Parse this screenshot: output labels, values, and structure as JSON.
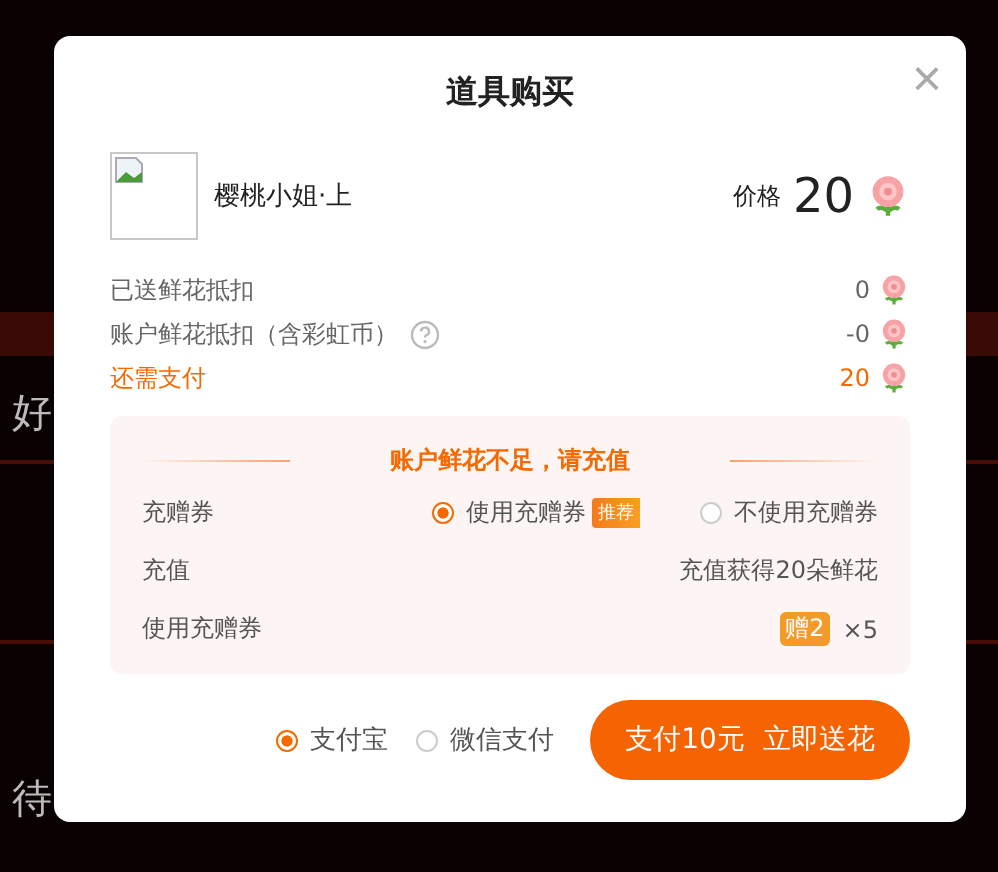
{
  "background": {
    "texts": [
      "好",
      "待"
    ]
  },
  "dialog": {
    "title": "道具购买",
    "close_symbol": "×"
  },
  "item": {
    "name": "樱桃小姐·上",
    "price_label": "价格",
    "price": "20"
  },
  "summary": [
    {
      "label": "已送鲜花抵扣",
      "value": "0",
      "kind": "normal",
      "help": false
    },
    {
      "label": "账户鲜花抵扣（含彩虹币）",
      "value": "-0",
      "kind": "normal",
      "help": true
    },
    {
      "label": "还需支付",
      "value": "20",
      "kind": "due",
      "help": false
    }
  ],
  "recharge": {
    "notice": "账户鲜花不足，请充值",
    "coupon_label": "充赠券",
    "coupon_options": [
      {
        "label": "使用充赠券",
        "badge": "推荐",
        "selected": true
      },
      {
        "label": "不使用充赠券",
        "selected": false
      }
    ],
    "recharge_label": "充值",
    "recharge_value": "充值获得20朵鲜花",
    "use_label": "使用充赠券",
    "use_tag": "赠2",
    "use_count": "×5"
  },
  "payment_methods": [
    {
      "label": "支付宝",
      "selected": true
    },
    {
      "label": "微信支付",
      "selected": false
    }
  ],
  "pay_button": "支付10元  立即送花"
}
